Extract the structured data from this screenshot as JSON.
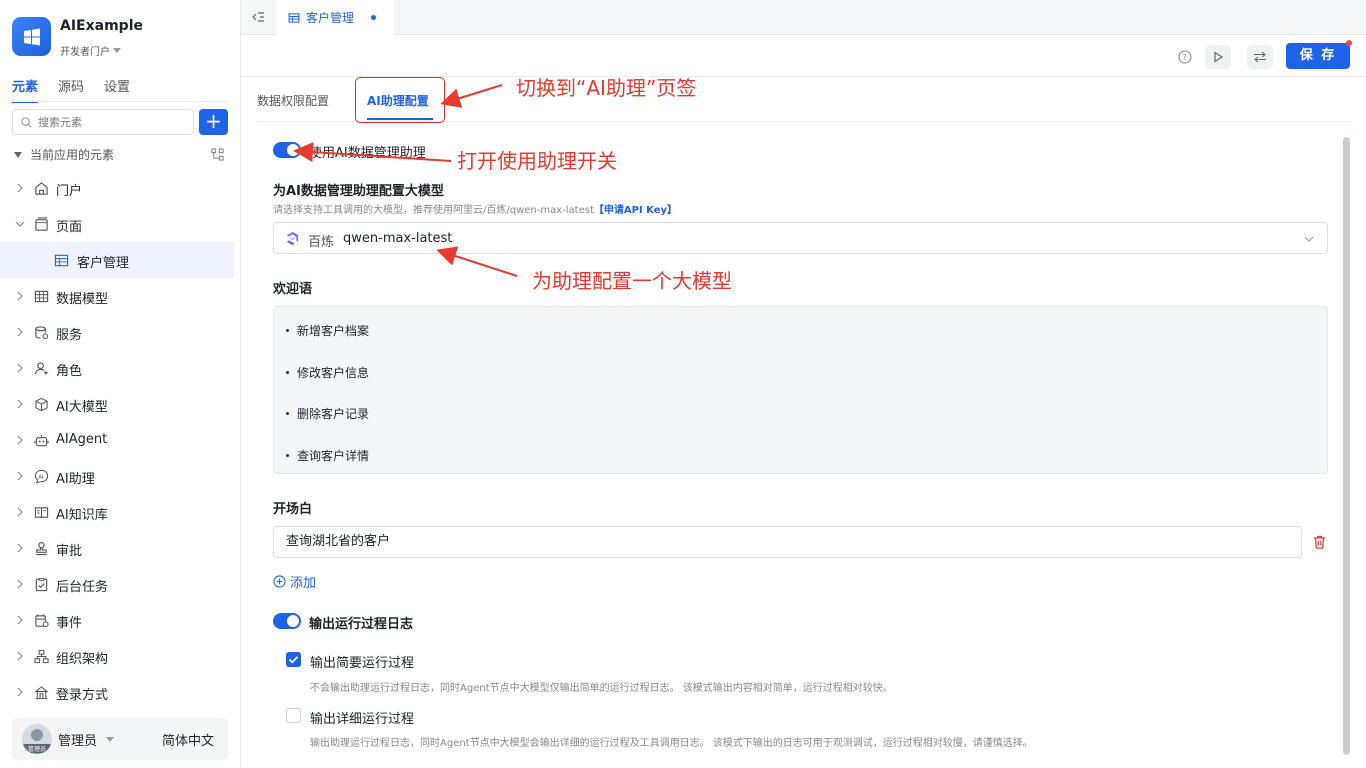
{
  "app": {
    "name": "AIExample",
    "portal": "开发者门户"
  },
  "sidebar": {
    "tabs": [
      "元素",
      "源码",
      "设置"
    ],
    "search_placeholder": "搜索元素",
    "add_label": "+",
    "section_title": "当前应用的元素",
    "items": [
      {
        "label": "门户",
        "icon": "home-icon"
      },
      {
        "label": "页面",
        "icon": "page-icon"
      },
      {
        "label": "客户管理",
        "icon": "table-icon"
      },
      {
        "label": "数据模型",
        "icon": "grid-icon"
      },
      {
        "label": "服务",
        "icon": "database-icon"
      },
      {
        "label": "角色",
        "icon": "user-role-icon"
      },
      {
        "label": "AI大模型",
        "icon": "cube-icon"
      },
      {
        "label": "AIAgent",
        "icon": "robot-icon"
      },
      {
        "label": "AI助理",
        "icon": "ai-assistant-icon"
      },
      {
        "label": "AI知识库",
        "icon": "book-icon"
      },
      {
        "label": "审批",
        "icon": "stamp-icon"
      },
      {
        "label": "后台任务",
        "icon": "task-icon"
      },
      {
        "label": "事件",
        "icon": "event-icon"
      },
      {
        "label": "组织架构",
        "icon": "org-icon"
      },
      {
        "label": "登录方式",
        "icon": "login-icon"
      }
    ],
    "user": {
      "name": "管理员",
      "badge": "管理员",
      "language": "简体中文"
    }
  },
  "topbar": {
    "tab_label": "客户管理"
  },
  "toolbar": {
    "save_label": "保 存"
  },
  "main": {
    "tabs": [
      "数据权限配置",
      "AI助理配置"
    ],
    "enable_switch_label": "使用AI数据管理助理",
    "model_section": {
      "title": "为AI数据管理助理配置大模型",
      "hint": "请选择支持工具调用的大模型，推荐使用阿里云/百炼/qwen-max-latest",
      "hint_link": "【申请API Key】",
      "provider": "百炼",
      "model": "qwen-max-latest"
    },
    "welcome": {
      "title": "欢迎语",
      "items": [
        "新增客户档案",
        "修改客户信息",
        "删除客户记录",
        "查询客户详情"
      ]
    },
    "opening": {
      "title": "开场白",
      "value": "查询湖北省的客户",
      "add_label": "添加"
    },
    "log": {
      "switch_label": "输出运行过程日志",
      "simple_label": "输出简要运行过程",
      "simple_desc": "不会输出助理运行过程日志，同时Agent节点中大模型仅输出简单的运行过程日志。 该模式输出内容相对简单，运行过程相对较快。",
      "detail_label": "输出详细运行过程",
      "detail_desc": "输出助理运行过程日志，同时Agent节点中大模型会输出详细的运行过程及工具调用日志。 该模式下输出的日志可用于观测调试，运行过程相对较慢，请谨慎选择。"
    }
  },
  "annotations": {
    "tab_hint": "切换到“AI助理”页签",
    "switch_hint": "打开使用助理开关",
    "model_hint": "为助理配置一个大模型"
  },
  "colors": {
    "accent": "#1f64e8",
    "annotation": "#e63b2e"
  }
}
